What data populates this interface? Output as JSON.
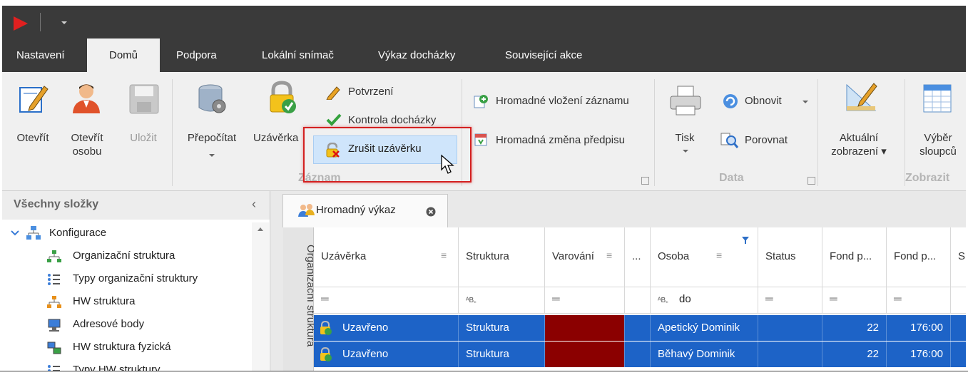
{
  "ribbon_tabs": [
    "Nastavení",
    "Domů",
    "Podpora",
    "Lokální snímač",
    "Výkaz docházky",
    "Související akce"
  ],
  "ribbon": {
    "otevrit": "Otevřít",
    "otevrit_osobu_1": "Otevřít",
    "otevrit_osobu_2": "osobu",
    "ulozit": "Uložit",
    "prepocitat": "Přepočítat",
    "uzaverka": "Uzávěrka",
    "potvrzeni": "Potvrzení",
    "kontrola": "Kontrola docházky",
    "zrusit": "Zrušit uzávěrku",
    "group_zaznam": "Záznam",
    "hromadne_vlozeni": "Hromadné vložení záznamu",
    "hromadna_zmena": "Hromadná změna předpisu",
    "tisk": "Tisk",
    "obnovit": "Obnovit",
    "porovnat": "Porovnat",
    "group_data": "Data",
    "aktualni_1": "Aktuální",
    "aktualni_2": "zobrazení",
    "vyber_1": "Výběr",
    "vyber_2": "sloupců",
    "group_zobrazit": "Zobrazit"
  },
  "left_panel": {
    "title": "Všechny složky",
    "items": [
      "Konfigurace",
      "Organizační struktura",
      "Typy organizační struktury",
      "HW struktura",
      "Adresové body",
      "HW struktura fyzická",
      "Typy HW struktury"
    ]
  },
  "document_tab": "Hromadný výkaz",
  "vertical_strip": "Organizační struktura",
  "grid": {
    "headers": [
      "Uzávěrka",
      "Struktura",
      "Varování",
      "...",
      "Osoba",
      "Status",
      "Fond p...",
      "Fond p...",
      "S"
    ],
    "filter_text": "do",
    "rows": [
      {
        "uzaverka": "Uzavřeno",
        "struktura": "Struktura",
        "osoba": "Apetický Dominik",
        "fond1": "22",
        "fond2": "176:00"
      },
      {
        "uzaverka": "Uzavřeno",
        "struktura": "Struktura",
        "osoba": "Běhavý Dominik",
        "fond1": "22",
        "fond2": "176:00"
      }
    ]
  },
  "colors": {
    "selection": "#1d63c7",
    "warning_cell": "#8b0000",
    "titlebar": "#3a3a3a",
    "highlight": "#d42020"
  }
}
